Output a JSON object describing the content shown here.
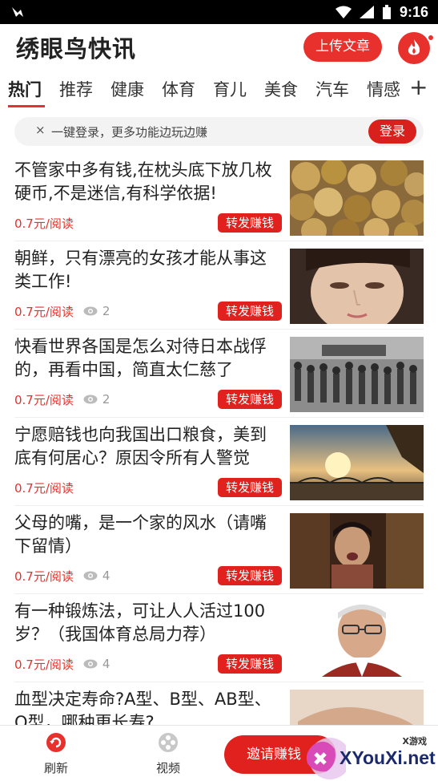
{
  "status_bar": {
    "time": "9:16"
  },
  "header": {
    "app_title": "绣眼鸟快讯",
    "upload_label": "上传文章"
  },
  "tabs": {
    "items": [
      {
        "label": "热门",
        "active": true
      },
      {
        "label": "推荐"
      },
      {
        "label": "健康"
      },
      {
        "label": "体育"
      },
      {
        "label": "育儿"
      },
      {
        "label": "美食"
      },
      {
        "label": "汽车"
      },
      {
        "label": "情感"
      }
    ],
    "add_label": "+"
  },
  "login_bar": {
    "close_label": "×",
    "text": "一键登录，更多功能边玩边赚",
    "button_label": "登录"
  },
  "news": [
    {
      "title": "不管家中多有钱,在枕头底下放几枚硬币,不是迷信,有科学依据!",
      "price": "0.7元/阅读",
      "views": "",
      "share_label": "转发赚钱",
      "thumb": "coins"
    },
    {
      "title": "朝鲜，只有漂亮的女孩才能从事这类工作!",
      "price": "0.7元/阅读",
      "views": "2",
      "share_label": "转发赚钱",
      "thumb": "girl"
    },
    {
      "title": "快看世界各国是怎么对待日本战俘的，再看中国，简直太仁慈了",
      "price": "0.7元/阅读",
      "views": "2",
      "share_label": "转发赚钱",
      "thumb": "soldiers"
    },
    {
      "title": "宁愿赔钱也向我国出口粮食，美到底有何居心？原因令所有人警觉",
      "price": "0.7元/阅读",
      "views": "",
      "share_label": "转发赚钱",
      "thumb": "grain"
    },
    {
      "title": "父母的嘴，是一个家的风水（请嘴下留情）",
      "price": "0.7元/阅读",
      "views": "4",
      "share_label": "转发赚钱",
      "thumb": "mother"
    },
    {
      "title": "有一种锻炼法，可让人人活过100岁？（我国体育总局力荐）",
      "price": "0.7元/阅读",
      "views": "4",
      "share_label": "转发赚钱",
      "thumb": "elder"
    },
    {
      "title": "血型决定寿命?A型、B型、AB型、O型，哪种更长寿?",
      "price": "",
      "views": "",
      "share_label": "",
      "thumb": "hand"
    }
  ],
  "bottom_bar": {
    "refresh_label": "刷新",
    "video_label": "视频",
    "invite_label": "邀请赚钱"
  },
  "watermark": {
    "tag": "X游戏",
    "text": "XYouXi.net"
  },
  "colors": {
    "accent": "#e8302d"
  }
}
